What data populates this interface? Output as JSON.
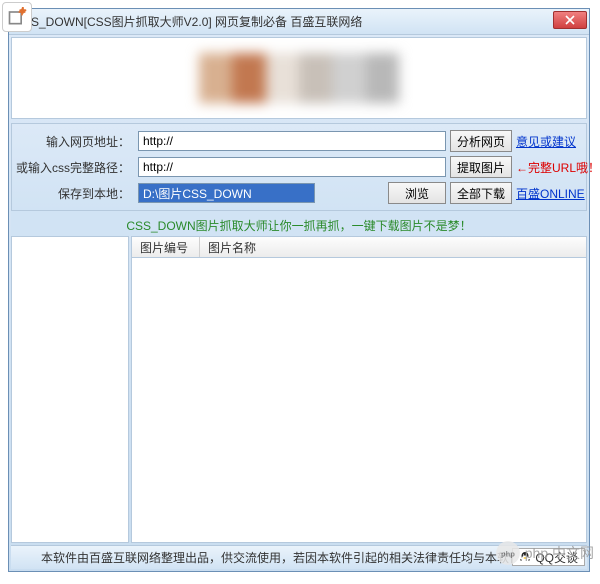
{
  "titlebar": {
    "title": "S_DOWN[CSS图片抓取大师V2.0] 网页复制必备 百盛互联网络"
  },
  "form": {
    "row1": {
      "label": "输入网页地址：",
      "value": "http://",
      "button": "分析网页",
      "side": "意见或建议"
    },
    "row2": {
      "label": "或输入css完整路径：",
      "value": "http://",
      "button": "提取图片",
      "side": "←完整URL哦！"
    },
    "row3": {
      "label": "保存到本地：",
      "value": "D:\\图片CSS_DOWN",
      "button1": "浏览",
      "button2": "全部下载",
      "side": "百盛ONLINE"
    }
  },
  "promo": "CSS_DOWN图片抓取大师让你一抓再抓，一键下载图片不是梦！",
  "table": {
    "col1": "图片编号",
    "col2": "图片名称"
  },
  "footer": {
    "text": "本软件由百盛互联网络整理出品，供交流使用，若因本软件引起的相关法律责任均与本软件无关！",
    "qq": "QQ交谈"
  },
  "watermark": "php 中文网"
}
